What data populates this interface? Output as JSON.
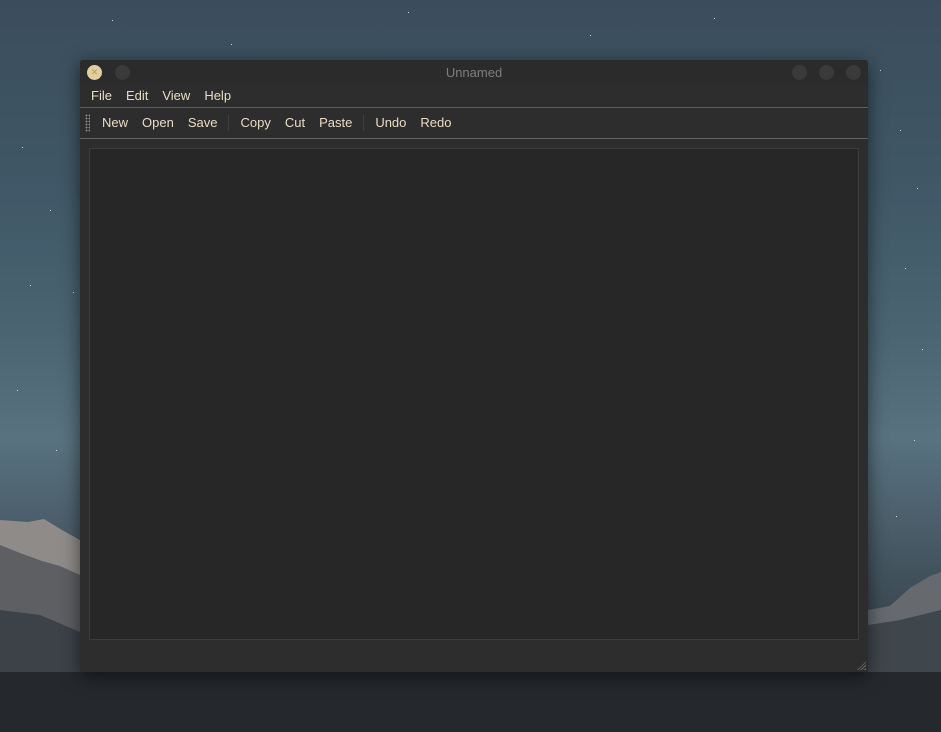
{
  "window": {
    "title": "Unnamed"
  },
  "menu": {
    "items": [
      {
        "label": "File"
      },
      {
        "label": "Edit"
      },
      {
        "label": "View"
      },
      {
        "label": "Help"
      }
    ]
  },
  "toolbar": {
    "new_label": "New",
    "open_label": "Open",
    "save_label": "Save",
    "copy_label": "Copy",
    "cut_label": "Cut",
    "paste_label": "Paste",
    "undo_label": "Undo",
    "redo_label": "Redo"
  },
  "editor": {
    "content": ""
  },
  "colors": {
    "accent": "#e3cf9e",
    "text": "#e8dcc3",
    "window_bg": "#2d2d2d",
    "editor_bg": "#272727"
  },
  "icons": {
    "close": "close-icon",
    "grip": "toolbar-grip-icon",
    "resize": "resize-grip-icon"
  }
}
